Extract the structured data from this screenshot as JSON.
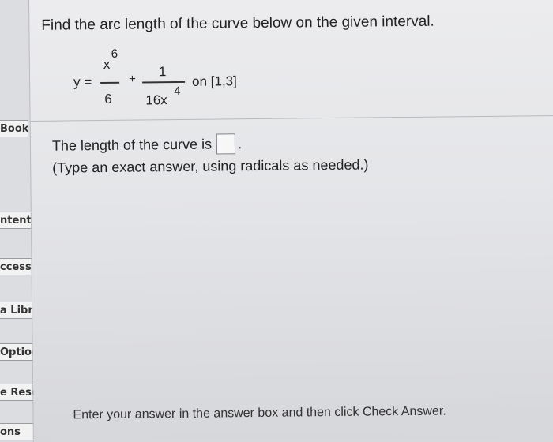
{
  "sidebar": {
    "items": [
      {
        "label": "Book"
      },
      {
        "label": "ntents"
      },
      {
        "label": "ccess"
      },
      {
        "label": "a Libra"
      },
      {
        "label": "Options"
      },
      {
        "label": "e Resou"
      },
      {
        "label": "ons"
      }
    ]
  },
  "question": {
    "title": "Find the arc length of the curve below on the given interval.",
    "equation": {
      "lhs": "y =",
      "frac1_num": "x",
      "frac1_num_exp": "6",
      "frac1_den": "6",
      "plus": "+",
      "frac2_num": "1",
      "frac2_den": "16x",
      "frac2_den_exp": "4",
      "interval": "on [1,3]"
    },
    "answer_prompt": "The length of the curve is",
    "answer_value": "",
    "answer_suffix": ".",
    "instruction": "(Type an exact answer, using radicals as needed.)"
  },
  "footer": {
    "instruction": "Enter your answer in the answer box and then click Check Answer."
  }
}
